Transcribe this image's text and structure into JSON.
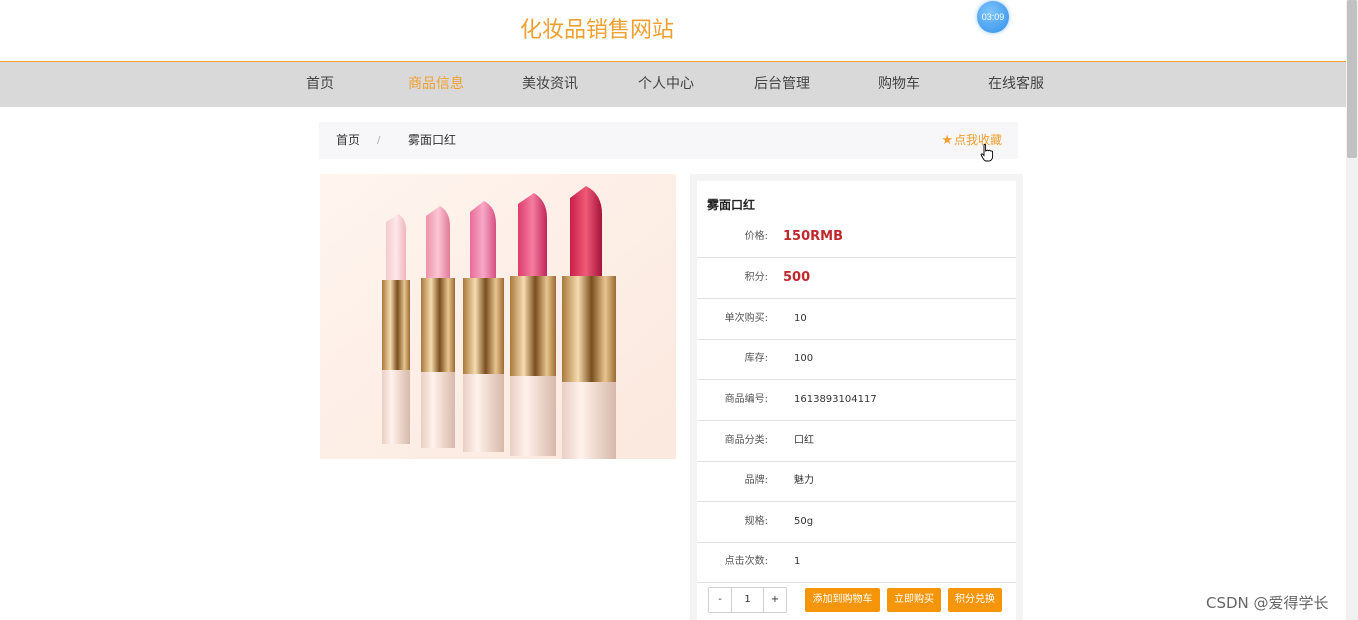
{
  "header": {
    "site_title": "化妆品销售网站",
    "timer": "03:09"
  },
  "nav": {
    "items": [
      {
        "label": "首页"
      },
      {
        "label": "商品信息",
        "active": true
      },
      {
        "label": "美妆资讯"
      },
      {
        "label": "个人中心"
      },
      {
        "label": "后台管理"
      },
      {
        "label": "购物车"
      },
      {
        "label": "在线客服"
      }
    ]
  },
  "breadcrumb": {
    "home": "首页",
    "separator": "/",
    "current": "雾面口红"
  },
  "favorite": {
    "label": "点我收藏",
    "icon": "star-icon"
  },
  "product": {
    "name": "雾面口红",
    "price_label": "价格:",
    "price_value": "150RMB",
    "points_label": "积分:",
    "points_value": "500",
    "single_label": "单次购买:",
    "single_value": "10",
    "stock_label": "库存:",
    "stock_value": "100",
    "code_label": "商品编号:",
    "code_value": "1613893104117",
    "category_label": "商品分类:",
    "category_value": "口红",
    "brand_label": "品牌:",
    "brand_value": "魅力",
    "spec_label": "规格:",
    "spec_value": "50g",
    "clicks_label": "点击次数:",
    "clicks_value": "1"
  },
  "quantity": {
    "minus": "-",
    "value": "1",
    "plus": "+"
  },
  "actions": {
    "add_cart": "添加到购物车",
    "buy_now": "立即购买",
    "points_exchange": "积分兑换"
  },
  "colors": {
    "accent": "#f0a030",
    "price": "#c0282d",
    "button": "#f5960a",
    "nav_bg": "#d9d9d9"
  },
  "watermark": "CSDN @爱得学长"
}
